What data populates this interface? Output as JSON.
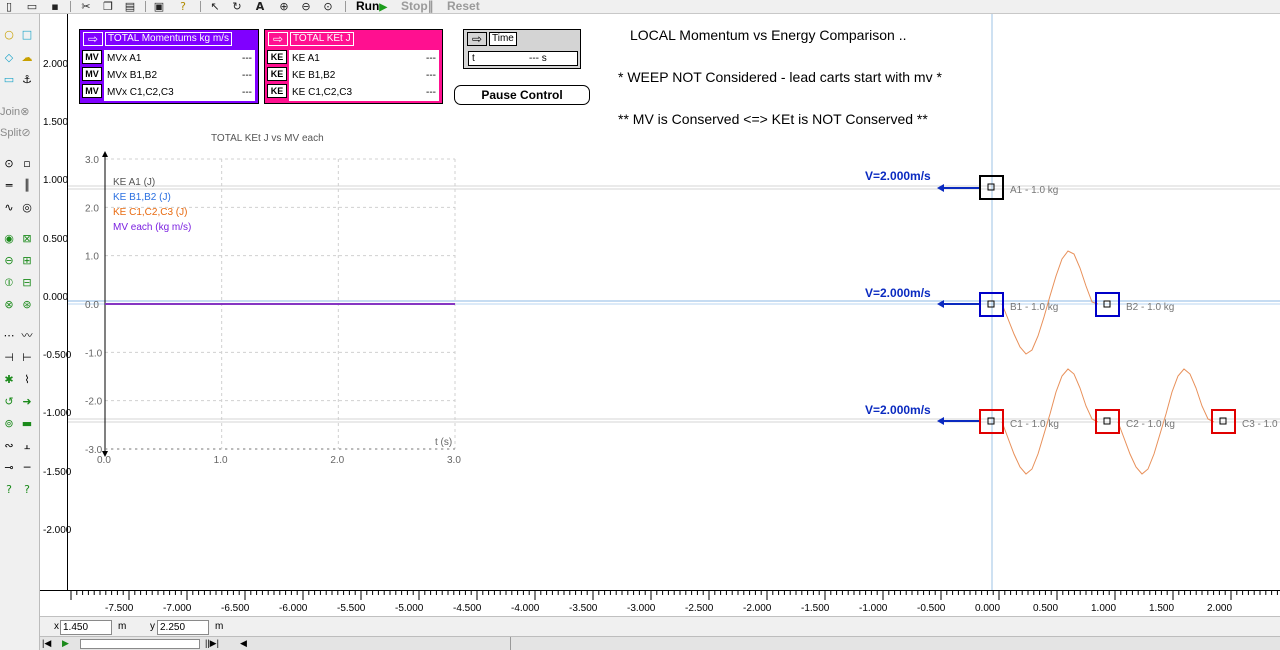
{
  "toolbar": {
    "icons": [
      "new-file-icon",
      "open-folder-icon",
      "save-icon",
      "cut-icon",
      "copy-icon",
      "paste-icon",
      "print-icon",
      "help-icon",
      "select-arrow-icon",
      "rotate-icon",
      "text-tool-icon",
      "zoom-in-icon",
      "zoom-out-icon",
      "zoom-fit-icon"
    ],
    "run_label": "Run",
    "stop_label": "Stop",
    "reset_label": "Reset"
  },
  "palette": {
    "join_label": "Join",
    "split_label": "Split"
  },
  "vertical_scale": [
    "2.000",
    "1.500",
    "1.000",
    "0.500",
    "0.000",
    "-0.500",
    "-1.000",
    "-1.500",
    "-2.000"
  ],
  "meters": {
    "momentum": {
      "title": "TOTAL Momentums kg m/s",
      "rows": [
        {
          "tag": "MV",
          "label": "MVx A1",
          "value": "---"
        },
        {
          "tag": "MV",
          "label": "MVx B1,B2",
          "value": "---"
        },
        {
          "tag": "MV",
          "label": "MVx C1,C2,C3",
          "value": "---"
        }
      ],
      "color": "#8000ff"
    },
    "energy": {
      "title": "TOTAL KEt J",
      "rows": [
        {
          "tag": "KE",
          "label": "KE A1",
          "value": "---"
        },
        {
          "tag": "KE",
          "label": "KE B1,B2",
          "value": "---"
        },
        {
          "tag": "KE",
          "label": "KE C1,C2,C3",
          "value": "---"
        }
      ],
      "color": "#ff1090"
    },
    "time": {
      "title": "Time",
      "field_label": "t",
      "field_value": "--- s"
    }
  },
  "pause_button": "Pause Control",
  "notes": {
    "line1": "LOCAL Momentum vs Energy Comparison ..",
    "line2": "* WEEP NOT Considered - lead carts start with mv *",
    "line3": "** MV is Conserved <=> KEt is NOT Conserved **"
  },
  "chart_data": {
    "type": "line",
    "title": "TOTAL KEt J vs MV each",
    "xlabel": "t (s)",
    "ylabel": "",
    "xlim": [
      0,
      3
    ],
    "ylim": [
      -3,
      3
    ],
    "x_ticks": [
      "0.0",
      "1.0",
      "2.0",
      "3.0"
    ],
    "y_ticks": [
      "3.0",
      "2.0",
      "1.0",
      "0.0",
      "-1.0",
      "-2.0",
      "-3.0"
    ],
    "series": [
      {
        "name": "KE A1 (J)",
        "color": "#555555",
        "points": [
          [
            0,
            0
          ],
          [
            3,
            0
          ]
        ]
      },
      {
        "name": "KE B1,B2 (J)",
        "color": "#2a6fe0",
        "points": [
          [
            0,
            0
          ],
          [
            3,
            0
          ]
        ]
      },
      {
        "name": "KE C1,C2,C3 (J)",
        "color": "#e86a10",
        "points": [
          [
            0,
            0
          ],
          [
            3,
            0
          ]
        ]
      },
      {
        "name": "MV each (kg m/s)",
        "color": "#7a1fe0",
        "points": [
          [
            0,
            0
          ],
          [
            3,
            0
          ]
        ]
      }
    ]
  },
  "carts": {
    "velocity_labels": [
      "V=2.000m/s",
      "V=2.000m/s",
      "V=2.000m/s"
    ],
    "a": [
      {
        "name": "A1 - 1.0 kg",
        "color": "#000000"
      }
    ],
    "b": [
      {
        "name": "B1 - 1.0 kg",
        "color": "#0000c8"
      },
      {
        "name": "B2 - 1.0 kg",
        "color": "#0000c8"
      }
    ],
    "c": [
      {
        "name": "C1 - 1.0 kg",
        "color": "#e00000"
      },
      {
        "name": "C2 - 1.0 kg",
        "color": "#e00000"
      },
      {
        "name": "C3 - 1.0",
        "color": "#e00000"
      }
    ]
  },
  "horizontal_ruler": [
    "-7.500",
    "-7.000",
    "-6.500",
    "-6.000",
    "-5.500",
    "-5.000",
    "-4.500",
    "-4.000",
    "-3.500",
    "-3.000",
    "-2.500",
    "-2.000",
    "-1.500",
    "-1.000",
    "-0.500",
    "0.000",
    "0.500",
    "1.000",
    "1.500",
    "2.000"
  ],
  "coordinates": {
    "x_label": "x",
    "x_value": "1.450",
    "x_unit": "m",
    "y_label": "y",
    "y_value": "2.250",
    "y_unit": "m"
  }
}
